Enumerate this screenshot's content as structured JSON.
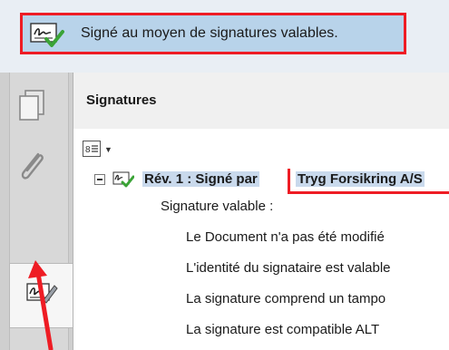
{
  "banner": {
    "text": "Signé au moyen de signatures valables.",
    "icon": "valid-signature-icon"
  },
  "rail": {
    "items": [
      {
        "name": "pages",
        "icon": "pages-icon"
      },
      {
        "name": "attachments",
        "icon": "paperclip-icon"
      },
      {
        "name": "signatures",
        "icon": "signature-pen-icon",
        "active": true
      }
    ]
  },
  "panel": {
    "title": "Signatures",
    "options_icon": "list-options-icon"
  },
  "tree": {
    "revision_label": "Rév. 1 : Signé par",
    "signer": "Tryg Forsikring A/S",
    "status": "Signature valable :",
    "details": [
      "Le Document n'a pas été modifié",
      "L'identité du signataire est valable",
      "La signature comprend un tampo",
      "La signature est compatible ALT"
    ]
  },
  "colors": {
    "highlight_red": "#ee1c24",
    "banner_blue": "#b8d3ea",
    "selection_blue": "#c9d9ec"
  }
}
